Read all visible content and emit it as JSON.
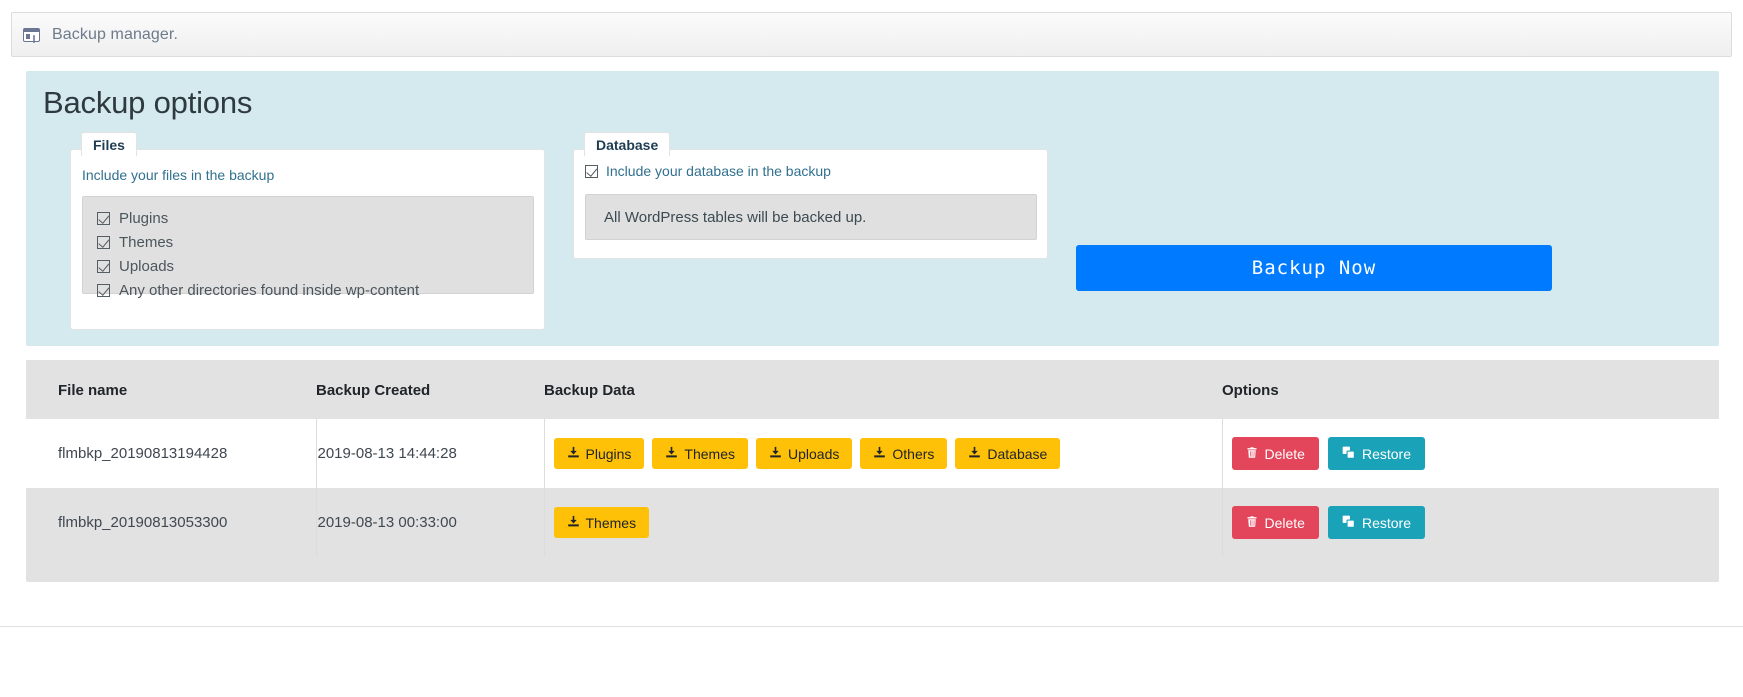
{
  "window": {
    "icon": "window-list-icon",
    "title": "Backup manager."
  },
  "options": {
    "heading": "Backup options",
    "files_card": {
      "legend": "Files",
      "subtitle": "Include your files in the backup",
      "checkboxes": [
        {
          "label": "Plugins",
          "checked": true
        },
        {
          "label": "Themes",
          "checked": true
        },
        {
          "label": "Uploads",
          "checked": true
        },
        {
          "label": "Any other directories found inside wp-content",
          "checked": true
        }
      ]
    },
    "database_card": {
      "legend": "Database",
      "checkbox": {
        "label": "Include your database in the backup",
        "checked": true
      },
      "note": "All WordPress tables will be backed up."
    },
    "backup_now_label": "Backup  Now"
  },
  "table": {
    "headers": [
      "File name",
      "Backup Created",
      "Backup Data",
      "Options"
    ],
    "rows": [
      {
        "file_name": "flmbkp_20190813194428",
        "created": "2019-08-13 14:44:28",
        "data_badges": [
          "Plugins",
          "Themes",
          "Uploads",
          "Others",
          "Database"
        ],
        "delete_label": "Delete",
        "restore_label": "Restore"
      },
      {
        "file_name": "flmbkp_20190813053300",
        "created": "2019-08-13 00:33:00",
        "data_badges": [
          "Themes"
        ],
        "delete_label": "Delete",
        "restore_label": "Restore"
      }
    ]
  },
  "colors": {
    "panel_bg": "#d5eaef",
    "primary": "#007bff",
    "badge": "#ffc107",
    "danger": "#e3455a",
    "info": "#19a2b8",
    "legend_text": "#1f3d52"
  }
}
